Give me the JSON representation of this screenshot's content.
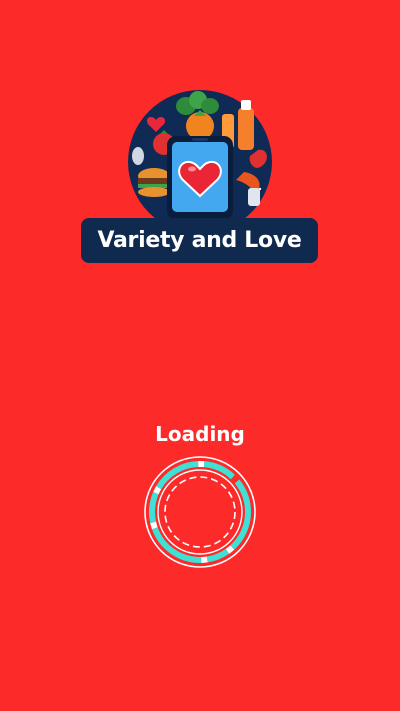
{
  "app": {
    "brand_name": "Variety and Love"
  },
  "loading": {
    "label": "Loading"
  },
  "icons": {
    "logo": "phone-with-heart-and-food-logo",
    "spinner": "loading-spinner-icon"
  },
  "colors": {
    "background": "#fd2a2a",
    "banner": "#10294e",
    "spinner_accent": "#3fe0d6",
    "text": "#ffffff"
  }
}
